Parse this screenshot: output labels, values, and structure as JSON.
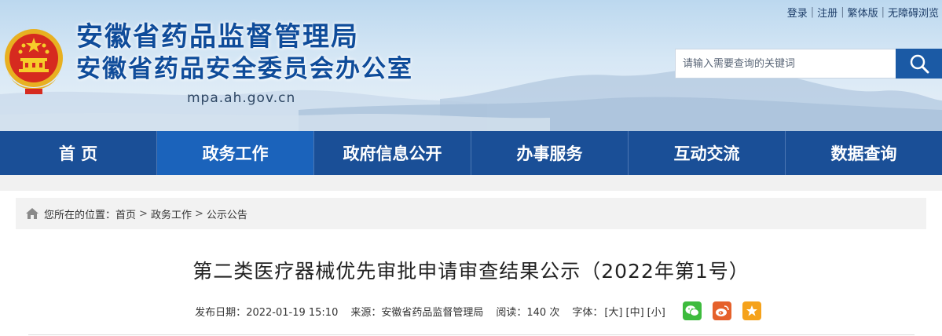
{
  "header": {
    "top_links": [
      "登录",
      "注册",
      "繁体版",
      "无障碍浏览"
    ],
    "title_main": "安徽省药品监督管理局",
    "title_sub": "安徽省药品安全委员会办公室",
    "domain": "mpa.ah.gov.cn",
    "search": {
      "placeholder": "请输入需要查询的关键词",
      "value": "",
      "icon": "search-icon"
    },
    "emblem": "national-emblem"
  },
  "nav": {
    "items": [
      "首 页",
      "政务工作",
      "政府信息公开",
      "办事服务",
      "互动交流",
      "数据查询"
    ],
    "active_index": 1
  },
  "breadcrumb": {
    "icon": "home-icon",
    "prefix": "您所在的位置：",
    "items": [
      "首页",
      "政务工作",
      "公示公告"
    ],
    "separator": ">"
  },
  "article": {
    "title": "第二类医疗器械优先审批申请审查结果公示（2022年第1号）",
    "meta": {
      "publish_label": "发布日期：",
      "publish_value": "2022-01-19 15:10",
      "source_label": "来源：",
      "source_value": "安徽省药品监督管理局",
      "read_label": "阅读：",
      "read_value": "140 次",
      "font_label": "字体：",
      "font_sizes": [
        "[大]",
        "[中]",
        "[小]"
      ]
    },
    "share_icons": [
      "wechat-icon",
      "weibo-icon",
      "favorite-icon"
    ]
  },
  "colors": {
    "nav_bg": "#1a4f97",
    "nav_active": "#1b63bb",
    "title_blue": "#0f4c9a",
    "search_button": "#1b5aa5"
  }
}
